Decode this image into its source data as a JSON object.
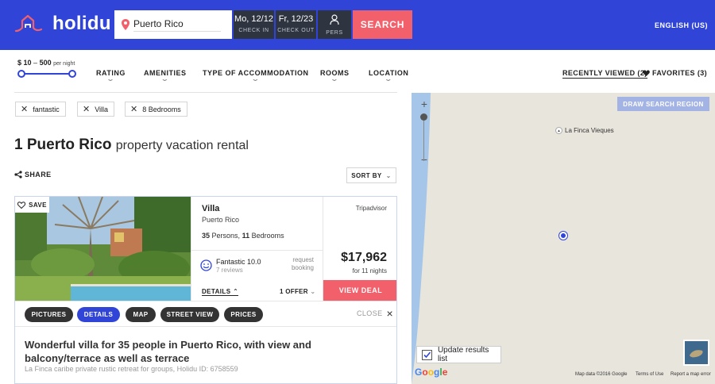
{
  "header": {
    "logo_text": "holidu",
    "search_value": "Puerto Rico",
    "checkin_date": "Mo, 12/12",
    "checkin_label": "CHECK IN",
    "checkout_date": "Fr, 12/23",
    "checkout_label": "CHECK OUT",
    "persons_label": "PERS",
    "search_button": "SEARCH",
    "language": "ENGLISH (US)"
  },
  "filters": {
    "price_min": "$ 10",
    "price_sep": "–",
    "price_max": "500",
    "price_unit": "per night",
    "slider_min_fraction": 0,
    "slider_max_fraction": 1,
    "items": [
      "RATING",
      "AMENITIES",
      "TYPE OF ACCOMMODATION",
      "ROOMS",
      "LOCATION"
    ],
    "recently_viewed": "RECENTLY VIEWED (2)",
    "favorites": "FAVORITES (3)"
  },
  "chips": [
    "fantastic",
    "Villa",
    "8 Bedrooms"
  ],
  "results": {
    "count_title": "1 Puerto Rico",
    "title_rest": "property vacation rental",
    "share": "SHARE",
    "sort": "SORT BY"
  },
  "listing": {
    "save": "SAVE",
    "type": "Villa",
    "location": "Puerto Rico",
    "persons_num": "35",
    "persons_word": "Persons,",
    "bedrooms_num": "11",
    "bedrooms_word": "Bedrooms",
    "rating": "Fantastic 10.0",
    "reviews": "7 reviews",
    "request": "request booking",
    "details": "DETAILS",
    "offer": "1 OFFER",
    "source": "Tripadvisor",
    "price": "$17,962",
    "nights": "for 11 nights",
    "view_deal": "VIEW DEAL",
    "tabs": [
      "PICTURES",
      "DETAILS",
      "MAP",
      "STREET VIEW",
      "PRICES"
    ],
    "active_tab": "DETAILS",
    "close": "CLOSE",
    "description_title": "Wonderful villa for 35 people in Puerto Rico, with view and balcony/terrace as well as terrace",
    "description_sub": "La Finca caribe private rustic retreat for groups, Holidu ID: 6758559"
  },
  "map": {
    "draw_button": "DRAW SEARCH REGION",
    "poi_label": "La Finca Vieques",
    "update_label": "Update results list",
    "update_checked": true,
    "google": "Google",
    "map_data": "Map data ©2016 Google",
    "terms": "Terms of Use",
    "report": "Report a map error"
  },
  "colors": {
    "brand_blue": "#3045d8",
    "accent_coral": "#f2606b",
    "dark": "#2e3440"
  }
}
